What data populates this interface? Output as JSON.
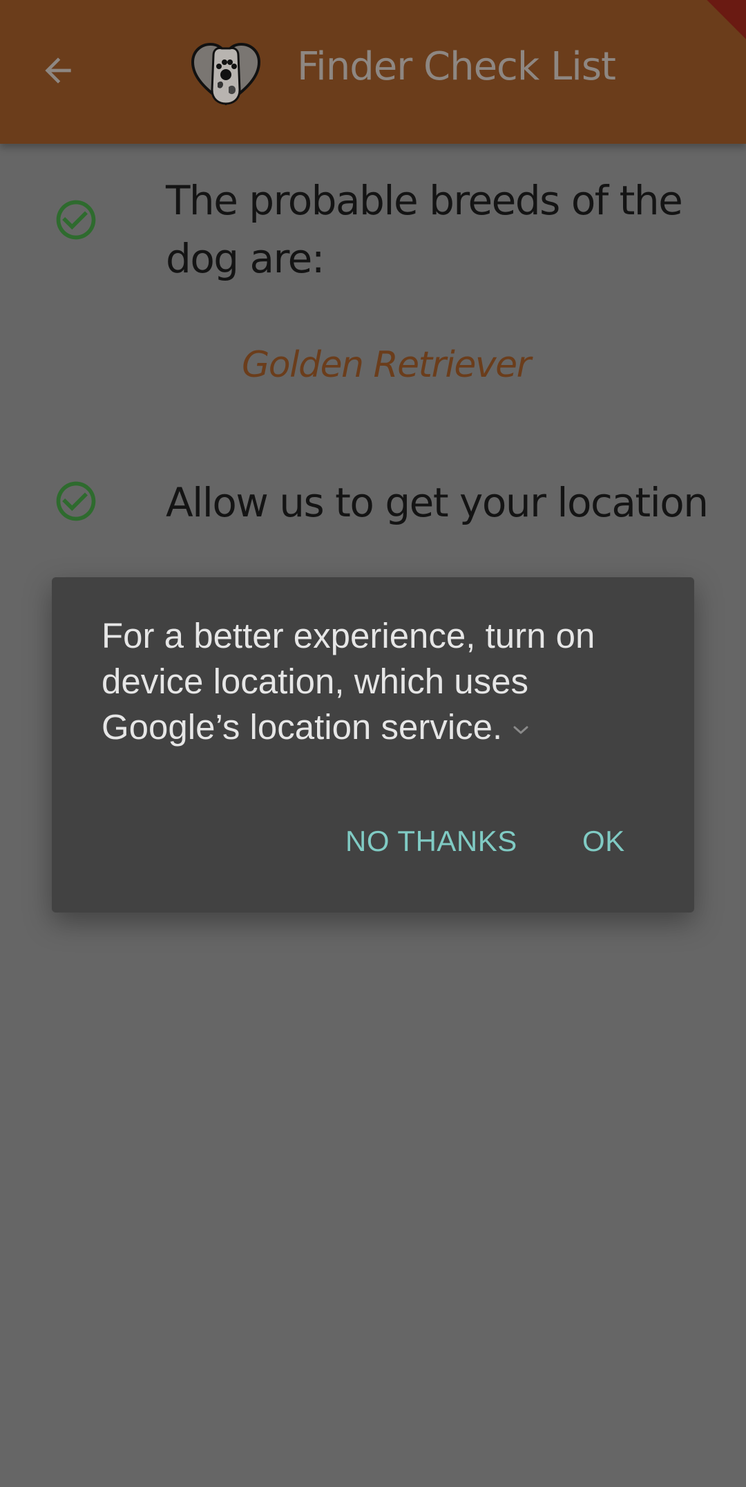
{
  "app_bar": {
    "title": "Finder Check List",
    "back_icon": "arrow-left-icon",
    "logo_icon": "heart-paw-logo",
    "background_color": "#6b3d1b"
  },
  "checklist": {
    "items": [
      {
        "label": "The probable breeds of the dog are:",
        "icon": "check-circle-icon",
        "status": "done"
      },
      {
        "label": "Allow us to get your location",
        "icon": "check-circle-icon",
        "status": "done"
      }
    ],
    "breeds": [
      "Golden Retriever"
    ],
    "check_color": "#2e6b2e",
    "breed_color": "#6b3d1b"
  },
  "dialog": {
    "message": "For a better experience, turn on device location, which uses Google’s location service.",
    "expand_icon": "chevron-down-icon",
    "buttons": {
      "no_thanks": "NO THANKS",
      "ok": "OK"
    },
    "button_color": "#80cbc4"
  }
}
